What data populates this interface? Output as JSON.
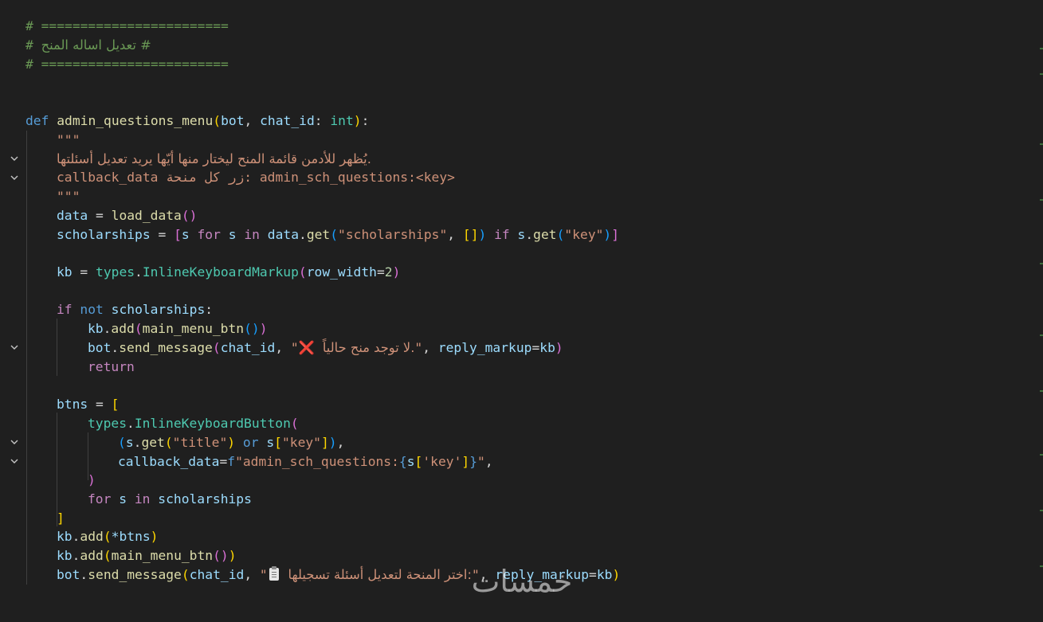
{
  "editor": {
    "language": "python",
    "lines": {
      "c1": "# ========================",
      "c2": "# تعديل اساله المنح",
      "c3": "# ========================",
      "def_kw": "def",
      "def_fn": "admin_questions_menu",
      "def_p1": "bot",
      "def_p2": "chat_id",
      "def_type": "int",
      "doc_open": "\"\"\"",
      "doc_line1": "يُظهر للأدمن قائمة المنح ليختار منها أيّها يريد تعديل أسئلتها.",
      "doc_line2": "callback_data زر كل منحة: admin_sch_questions:<key>",
      "doc_close": "\"\"\"",
      "data_var": "data",
      "load_fn": "load_data",
      "sch_var": "scholarships",
      "s_var": "s",
      "get_fn": "get",
      "str_scholarships": "\"scholarships\"",
      "str_key": "\"key\"",
      "kb_var": "kb",
      "types_cls": "types",
      "ikm_cls": "InlineKeyboardMarkup",
      "row_width": "row_width",
      "row_num": "2",
      "if_kw": "if",
      "not_kw": "not",
      "add_fn": "add",
      "main_btn_fn": "main_menu_btn",
      "send_fn": "send_message",
      "msg_none": "لا توجد منح حالياً.",
      "cross_icon": "❌",
      "reply_markup": "reply_markup",
      "return_kw": "return",
      "btns_var": "btns",
      "ikb_cls": "InlineKeyboardButton",
      "str_title": "\"title\"",
      "or_kw": "or",
      "callback_data": "callback_data",
      "fstr_prefix": "f",
      "fstr_text": "\"admin_sch_questions:",
      "key_single": "'key'",
      "for_kw": "for",
      "in_kw": "in",
      "star_btns": "*btns",
      "msg_pick": "اختر المنحة لتعديل أسئلة تسجيلها:"
    }
  },
  "watermark": {
    "text": "خمسات"
  },
  "colors": {
    "background": "#1f1f1f",
    "keyword": "#569cd6",
    "control": "#c586c0",
    "function": "#dcdcaa",
    "variable": "#9cdcfe",
    "string": "#ce9178",
    "class": "#4ec9b0",
    "number": "#b5cea8",
    "comment": "#6a9955"
  }
}
